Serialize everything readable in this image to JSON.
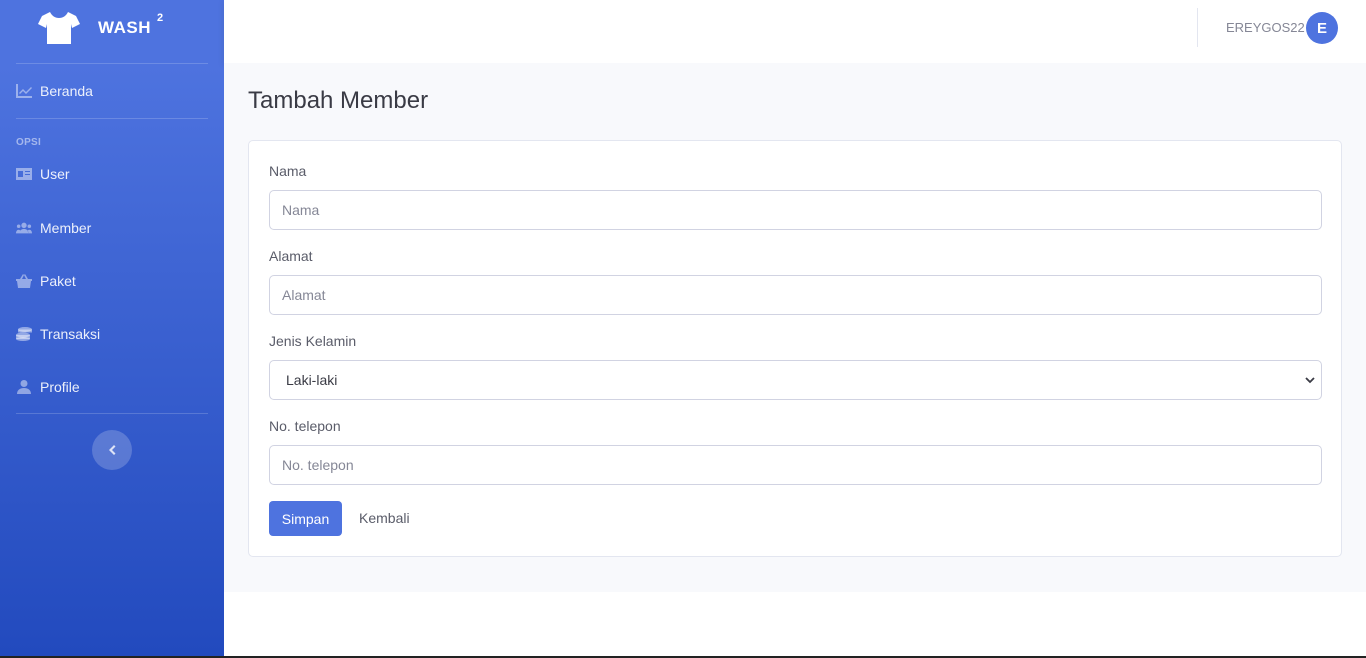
{
  "brand": {
    "name": "WASH",
    "sup": "2"
  },
  "sidebar": {
    "beranda": "Beranda",
    "heading": "OPSI",
    "items": [
      {
        "label": "User",
        "icon": "id-card-icon"
      },
      {
        "label": "Member",
        "icon": "users-icon"
      },
      {
        "label": "Paket",
        "icon": "basket-icon"
      },
      {
        "label": "Transaksi",
        "icon": "coins-icon"
      },
      {
        "label": "Profile",
        "icon": "user-icon"
      }
    ]
  },
  "topbar": {
    "username": "EREYGOS22",
    "avatar_initial": "E"
  },
  "page": {
    "title": "Tambah Member"
  },
  "form": {
    "nama_label": "Nama",
    "nama_placeholder": "Nama",
    "alamat_label": "Alamat",
    "alamat_placeholder": "Alamat",
    "jk_label": "Jenis Kelamin",
    "jk_selected": "Laki-laki",
    "telp_label": "No. telepon",
    "telp_placeholder": "No. telepon",
    "save_label": "Simpan",
    "back_label": "Kembali"
  },
  "colors": {
    "primary": "#4e73df",
    "sidebar_end": "#224abe"
  }
}
